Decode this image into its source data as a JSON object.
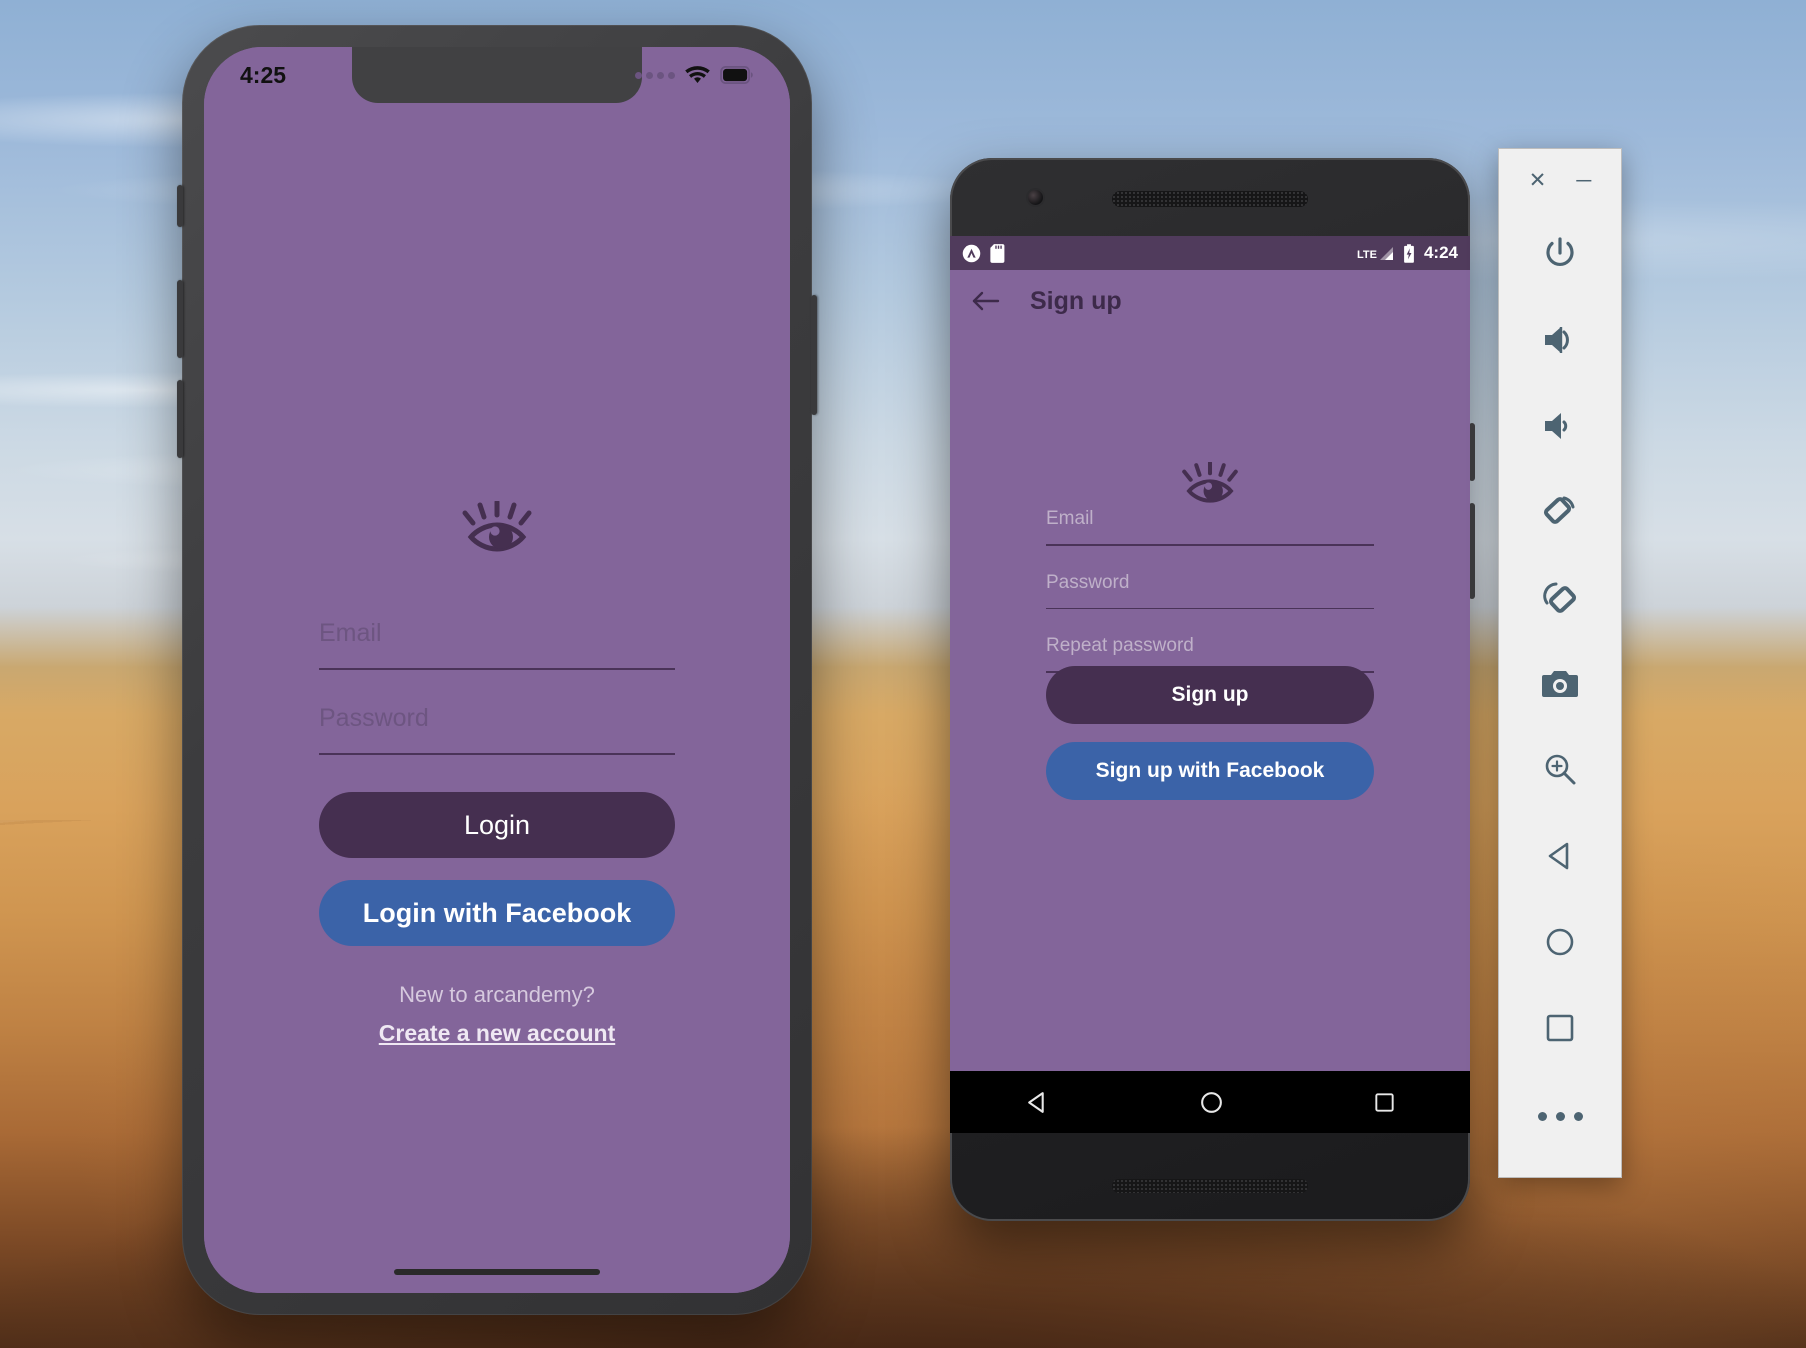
{
  "desktop": {
    "wallpaper_name": "mojave-desert-wallpaper"
  },
  "colors": {
    "app_background": "#83659a",
    "primary_button": "#452f50",
    "facebook_button": "#3b63a8",
    "android_statusbar": "#503b5c",
    "toolbar_icon": "#4d6472",
    "field_rule": "#4a3358"
  },
  "iphone": {
    "device_name": "iPhone X Simulator",
    "status_bar": {
      "time": "4:25",
      "signal_icon": "signal-dots-icon",
      "wifi_icon": "wifi-icon",
      "battery_icon": "battery-full-icon"
    },
    "app": {
      "logo_icon": "eye-logo-icon",
      "fields": [
        {
          "name": "email",
          "placeholder": "Email",
          "value": ""
        },
        {
          "name": "password",
          "placeholder": "Password",
          "value": ""
        }
      ],
      "primary_button": "Login",
      "facebook_button": "Login with Facebook",
      "footer_question": "New to arcandemy?",
      "footer_link": "Create a new account"
    },
    "home_indicator": "home-indicator"
  },
  "android": {
    "device_name": "Nexus Android Emulator",
    "status_bar": {
      "app_icon": "app-notification-icon",
      "sdcard_icon": "sdcard-icon",
      "network_label": "LTE",
      "signal_icon": "signal-bars-icon",
      "battery_icon": "battery-charging-icon",
      "time": "4:24"
    },
    "app_bar": {
      "back_icon": "back-arrow-icon",
      "title": "Sign up"
    },
    "app": {
      "logo_icon": "eye-logo-icon",
      "fields": [
        {
          "name": "email",
          "placeholder": "Email",
          "value": ""
        },
        {
          "name": "password",
          "placeholder": "Password",
          "value": ""
        },
        {
          "name": "repeat_password",
          "placeholder": "Repeat password",
          "value": ""
        }
      ],
      "primary_button": "Sign up",
      "facebook_button": "Sign up with Facebook"
    },
    "nav_bar": {
      "back_icon": "nav-back-triangle-icon",
      "home_icon": "nav-home-circle-icon",
      "recents_icon": "nav-recents-square-icon"
    }
  },
  "emulator_toolbar": {
    "window_controls": [
      {
        "name": "close",
        "glyph": "✕"
      },
      {
        "name": "minimize",
        "glyph": "─"
      }
    ],
    "tools": [
      {
        "name": "power-button",
        "icon": "power-icon"
      },
      {
        "name": "volume-up-button",
        "icon": "volume-up-icon"
      },
      {
        "name": "volume-down-button",
        "icon": "volume-down-icon"
      },
      {
        "name": "rotate-left-button",
        "icon": "rotate-left-icon"
      },
      {
        "name": "rotate-right-button",
        "icon": "rotate-right-icon"
      },
      {
        "name": "screenshot-button",
        "icon": "camera-icon"
      },
      {
        "name": "zoom-button",
        "icon": "magnifier-plus-icon"
      },
      {
        "name": "back-button",
        "icon": "back-triangle-icon"
      },
      {
        "name": "home-button",
        "icon": "home-circle-icon"
      },
      {
        "name": "overview-button",
        "icon": "overview-square-icon"
      }
    ],
    "more_button": {
      "name": "more-options",
      "icon": "ellipsis-icon"
    }
  }
}
